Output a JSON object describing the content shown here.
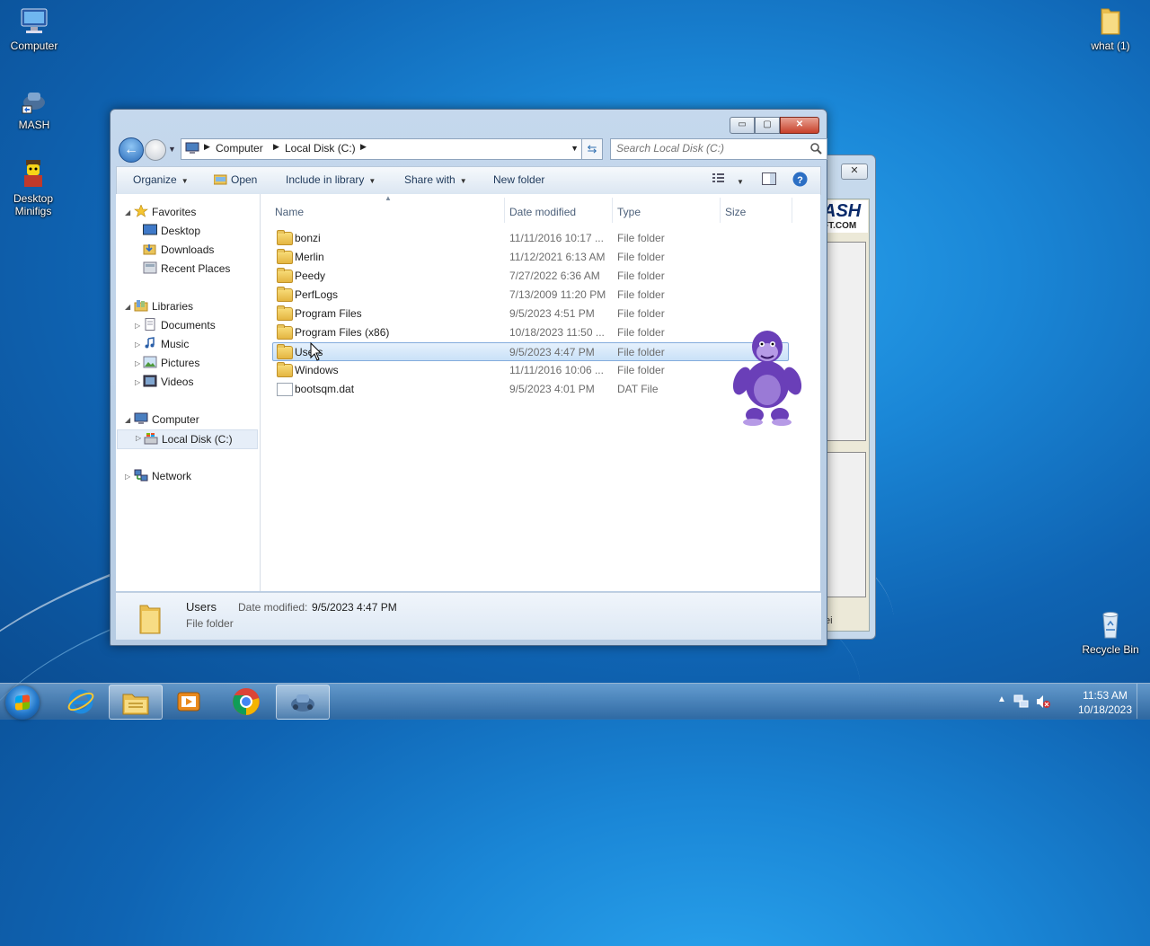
{
  "desktop": {
    "icons": [
      {
        "label": "Computer"
      },
      {
        "label": "MASH"
      },
      {
        "label": "Desktop Minifigs"
      },
      {
        "label": "what (1)"
      },
      {
        "label": "Recycle Bin"
      }
    ]
  },
  "background_window": {
    "close_label": "✕",
    "logo_text": "ASH",
    "logo_sub": "FT.COM",
    "fragment_text": "ei"
  },
  "explorer": {
    "caption_buttons": {
      "minimize": "▭",
      "maximize": "▢",
      "close": "✕"
    },
    "address": {
      "crumbs": [
        "Computer",
        "Local Disk (C:)"
      ]
    },
    "search": {
      "placeholder": "Search Local Disk (C:)"
    },
    "toolbar": {
      "organize": "Organize",
      "open": "Open",
      "include_in_library": "Include in library",
      "share_with": "Share with",
      "new_folder": "New folder"
    },
    "nav": {
      "favorites": "Favorites",
      "desktop": "Desktop",
      "downloads": "Downloads",
      "recent_places": "Recent Places",
      "libraries": "Libraries",
      "documents": "Documents",
      "music": "Music",
      "pictures": "Pictures",
      "videos": "Videos",
      "computer": "Computer",
      "local_disk": "Local Disk (C:)",
      "network": "Network"
    },
    "columns": {
      "name": "Name",
      "date": "Date modified",
      "type": "Type",
      "size": "Size"
    },
    "files": [
      {
        "name": "bonzi",
        "date": "11/11/2016 10:17 ...",
        "type": "File folder",
        "kind": "folder"
      },
      {
        "name": "Merlin",
        "date": "11/12/2021 6:13 AM",
        "type": "File folder",
        "kind": "folder"
      },
      {
        "name": "Peedy",
        "date": "7/27/2022 6:36 AM",
        "type": "File folder",
        "kind": "folder"
      },
      {
        "name": "PerfLogs",
        "date": "7/13/2009 11:20 PM",
        "type": "File folder",
        "kind": "folder"
      },
      {
        "name": "Program Files",
        "date": "9/5/2023 4:51 PM",
        "type": "File folder",
        "kind": "folder"
      },
      {
        "name": "Program Files (x86)",
        "date": "10/18/2023 11:50 ...",
        "type": "File folder",
        "kind": "folder"
      },
      {
        "name": "Users",
        "date": "9/5/2023 4:47 PM",
        "type": "File folder",
        "kind": "folder",
        "selected": true
      },
      {
        "name": "Windows",
        "date": "11/11/2016 10:06 ...",
        "type": "File folder",
        "kind": "folder"
      },
      {
        "name": "bootsqm.dat",
        "date": "9/5/2023 4:01 PM",
        "type": "DAT File",
        "kind": "file"
      }
    ],
    "details": {
      "name": "Users",
      "type": "File folder",
      "date_label": "Date modified:",
      "date_value": "9/5/2023 4:47 PM"
    }
  },
  "taskbar": {
    "time": "11:53 AM",
    "date": "10/18/2023"
  },
  "colors": {
    "selection": "#c9e1f8",
    "window_frame": "#b6cbe2",
    "desktop": "#1a86d6"
  }
}
